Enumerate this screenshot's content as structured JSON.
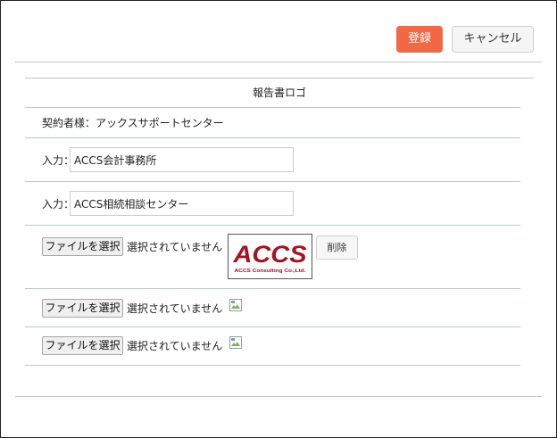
{
  "toolbar": {
    "register_label": "登録",
    "cancel_label": "キャンセル",
    "register_color": "#f26744"
  },
  "form": {
    "title": "報告書ロゴ",
    "contractor": "契約者様：アックスサポートセンター",
    "inputs": [
      {
        "label": "入力：",
        "value": "ACCS会計事務所"
      },
      {
        "label": "入力：",
        "value": "ACCS相続相談センター"
      }
    ],
    "files": [
      {
        "button": "ファイルを選択",
        "status": "選択されていません",
        "image": "accs-logo",
        "delete_label": "削除"
      },
      {
        "button": "ファイルを選択",
        "status": "選択されていません",
        "image": "broken-image-icon"
      },
      {
        "button": "ファイルを選択",
        "status": "選択されていません",
        "image": "broken-image-icon"
      }
    ]
  },
  "logo": {
    "text": "ACCS",
    "subtext": "ACCS Consulting Co.,Ltd.",
    "color": "#a3141f"
  }
}
